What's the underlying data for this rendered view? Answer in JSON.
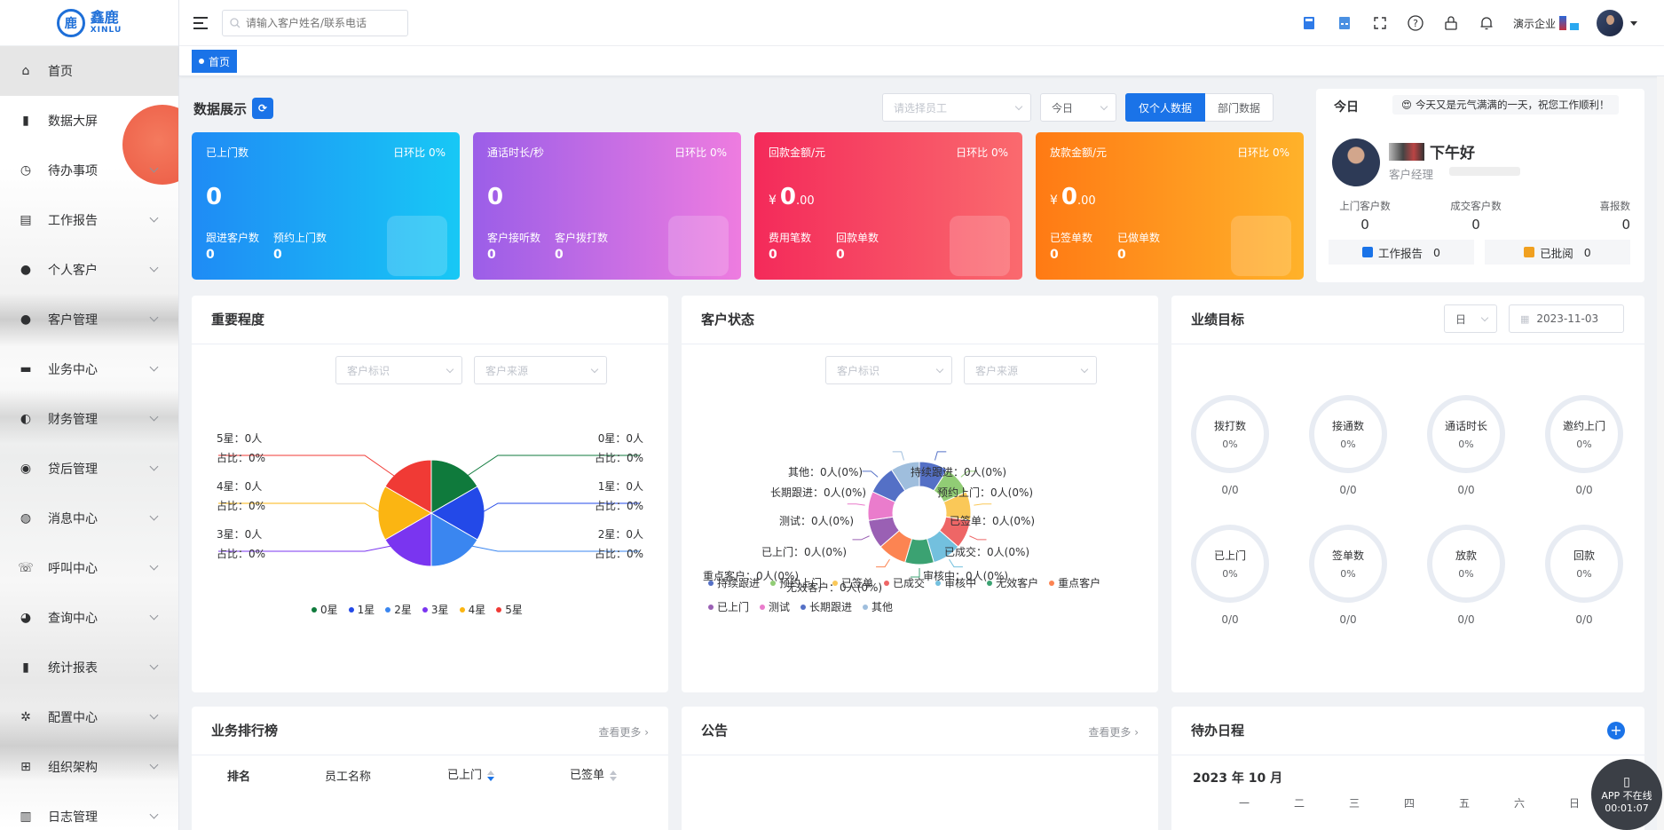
{
  "logo": {
    "cn": "鑫鹿",
    "en": "XINLU"
  },
  "sidebar": {
    "items": [
      {
        "label": "首页",
        "icon": "home-icon",
        "active": true,
        "has_children": false
      },
      {
        "label": "数据大屏",
        "icon": "bar-chart-icon",
        "has_children": false
      },
      {
        "label": "待办事项",
        "icon": "clock-icon",
        "has_children": true
      },
      {
        "label": "工作报告",
        "icon": "document-icon",
        "has_children": true
      },
      {
        "label": "个人客户",
        "icon": "user-icon",
        "has_children": true
      },
      {
        "label": "客户管理",
        "icon": "users-icon",
        "has_children": true
      },
      {
        "label": "业务中心",
        "icon": "briefcase-icon",
        "has_children": true
      },
      {
        "label": "财务管理",
        "icon": "money-bag-icon",
        "has_children": true
      },
      {
        "label": "贷后管理",
        "icon": "user-settings-icon",
        "has_children": true
      },
      {
        "label": "消息中心",
        "icon": "message-icon",
        "has_children": true
      },
      {
        "label": "呼叫中心",
        "icon": "phone-icon",
        "has_children": true
      },
      {
        "label": "查询中心",
        "icon": "search-bubble-icon",
        "has_children": true
      },
      {
        "label": "统计报表",
        "icon": "stats-icon",
        "has_children": true
      },
      {
        "label": "配置中心",
        "icon": "gear-icon",
        "has_children": true
      },
      {
        "label": "组织架构",
        "icon": "org-chart-icon",
        "has_children": true
      },
      {
        "label": "日志管理",
        "icon": "log-icon",
        "has_children": true
      }
    ]
  },
  "topbar": {
    "search_placeholder": "请输入客户姓名/联系电话",
    "company": "演示企业"
  },
  "tab": {
    "label": "首页"
  },
  "display": {
    "title": "数据展示",
    "employee_placeholder": "请选择员工",
    "period": "今日",
    "btn_personal": "仅个人数据",
    "btn_dept": "部门数据"
  },
  "cards": [
    {
      "title": "已上门数",
      "ratio": "日环比 0%",
      "value": "0",
      "sub": [
        {
          "label": "跟进客户数",
          "value": "0"
        },
        {
          "label": "预约上门数",
          "value": "0"
        }
      ]
    },
    {
      "title": "通话时长/秒",
      "ratio": "日环比 0%",
      "value": "0",
      "sub": [
        {
          "label": "客户接听数",
          "value": "0"
        },
        {
          "label": "客户拨打数",
          "value": "0"
        }
      ]
    },
    {
      "title": "回款金额/元",
      "ratio": "日环比 0%",
      "currency": "¥",
      "value": "0",
      "decimals": ".00",
      "sub": [
        {
          "label": "费用笔数",
          "value": "0"
        },
        {
          "label": "回款单数",
          "value": "0"
        }
      ]
    },
    {
      "title": "放款金额/元",
      "ratio": "日环比 0%",
      "currency": "¥",
      "value": "0",
      "decimals": ".00",
      "sub": [
        {
          "label": "已签单数",
          "value": "0"
        },
        {
          "label": "已做单数",
          "value": "0"
        }
      ]
    }
  ],
  "greeting": {
    "today": "今日",
    "banner": "今天又是元气满满的一天，祝您工作顺利！",
    "hello": "下午好",
    "role": "客户经理",
    "stats": [
      {
        "label": "上门客户数",
        "value": "0"
      },
      {
        "label": "成交客户数",
        "value": "0"
      },
      {
        "label": "喜报数",
        "value": "0"
      }
    ],
    "work_report": {
      "label": "工作报告",
      "value": "0"
    },
    "reviewed": {
      "label": "已批阅",
      "value": "0"
    }
  },
  "importance": {
    "title": "重要程度",
    "filter1": "客户标识",
    "filter2": "客户来源",
    "labels": [
      {
        "name": "5星：0人",
        "pct": "占比：0%"
      },
      {
        "name": "4星：0人",
        "pct": "占比：0%"
      },
      {
        "name": "3星：0人",
        "pct": "占比：0%"
      },
      {
        "name": "0星：0人",
        "pct": "占比：0%"
      },
      {
        "name": "1星：0人",
        "pct": "占比：0%"
      },
      {
        "name": "2星：0人",
        "pct": "占比：0%"
      }
    ],
    "legend": [
      {
        "name": "0星",
        "color": "#0f7a3c"
      },
      {
        "name": "1星",
        "color": "#2349e8"
      },
      {
        "name": "2星",
        "color": "#3a86f0"
      },
      {
        "name": "3星",
        "color": "#7a35f0"
      },
      {
        "name": "4星",
        "color": "#fbb512"
      },
      {
        "name": "5星",
        "color": "#f03a35"
      }
    ]
  },
  "chart_data": [
    {
      "type": "pie",
      "title": "重要程度",
      "categories": [
        "0星",
        "1星",
        "2星",
        "3星",
        "4星",
        "5星"
      ],
      "values": [
        0,
        0,
        0,
        0,
        0,
        0
      ],
      "counts_label": "0人",
      "share": "0%"
    },
    {
      "type": "pie",
      "title": "客户状态",
      "categories": [
        "持续跟进",
        "预约上门",
        "已签单",
        "已成交",
        "审核中",
        "无效客户",
        "重点客户",
        "已上门",
        "测试",
        "长期跟进",
        "其他"
      ],
      "values": [
        0,
        0,
        0,
        0,
        0,
        0,
        0,
        0,
        0,
        0,
        0
      ]
    }
  ],
  "status": {
    "title": "客户状态",
    "filter1": "客户标识",
    "filter2": "客户来源",
    "labels": [
      "持续跟进：0人(0%)",
      "预约上门：0人(0%)",
      "已签单：0人(0%)",
      "已成交：0人(0%)",
      "审核中：0人(0%)",
      "无效客户：0人(0%)",
      "重点客户：0人(0%)",
      "已上门：0人(0%)",
      "测试：0人(0%)",
      "长期跟进：0人(0%)",
      "其他：0人(0%)"
    ],
    "legend": [
      {
        "name": "持续跟进",
        "color": "#5470c6"
      },
      {
        "name": "预约上门",
        "color": "#91cc75"
      },
      {
        "name": "已签单",
        "color": "#fac858"
      },
      {
        "name": "已成交",
        "color": "#ee6666"
      },
      {
        "name": "审核中",
        "color": "#73c0de"
      },
      {
        "name": "无效客户",
        "color": "#3ba272"
      },
      {
        "name": "重点客户",
        "color": "#fc8452"
      },
      {
        "name": "已上门",
        "color": "#9a60b4"
      },
      {
        "name": "测试",
        "color": "#ea7ccc"
      },
      {
        "name": "长期跟进",
        "color": "#5470c6"
      },
      {
        "name": "其他",
        "color": "#9fbedd"
      }
    ]
  },
  "target": {
    "title": "业绩目标",
    "unit": "日",
    "date": "2023-11-03",
    "items": [
      {
        "label": "拨打数",
        "pct": "0%",
        "ratio": "0/0"
      },
      {
        "label": "接通数",
        "pct": "0%",
        "ratio": "0/0"
      },
      {
        "label": "通话时长",
        "pct": "0%",
        "ratio": "0/0"
      },
      {
        "label": "邀约上门",
        "pct": "0%",
        "ratio": "0/0"
      },
      {
        "label": "已上门",
        "pct": "0%",
        "ratio": "0/0"
      },
      {
        "label": "签单数",
        "pct": "0%",
        "ratio": "0/0"
      },
      {
        "label": "放款",
        "pct": "0%",
        "ratio": "0/0"
      },
      {
        "label": "回款",
        "pct": "0%",
        "ratio": "0/0"
      }
    ]
  },
  "ranking": {
    "title": "业务排行榜",
    "more": "查看更多",
    "cols": [
      "排名",
      "员工名称",
      "已上门",
      "已签单"
    ]
  },
  "notice": {
    "title": "公告",
    "more": "查看更多"
  },
  "schedule": {
    "title": "待办日程",
    "month": "2023 年 10 月",
    "weekdays": [
      "一",
      "二",
      "三",
      "四",
      "五",
      "六",
      "日"
    ]
  },
  "app_badge": {
    "status": "APP 不在线",
    "time": "00:01:07"
  }
}
